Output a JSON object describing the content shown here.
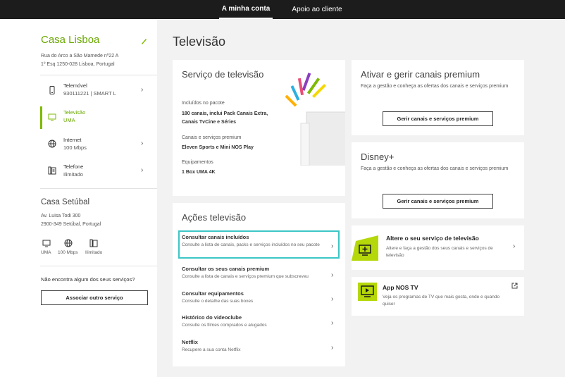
{
  "nav": {
    "tab1": "A minha conta",
    "tab2": "Apoio ao cliente"
  },
  "colors": {
    "brand": "#7dba00",
    "highlight": "#3cc6c6",
    "topbar": "#1c1c1c"
  },
  "sidebar": {
    "account1": {
      "name": "Casa Lisboa",
      "address_line1": "Rua do Arco a São Mamede nº22 A",
      "address_line2": "1º Esq 1250-028 Lisboa, Portugal",
      "services": [
        {
          "name": "Telemóvel",
          "detail": "930111221 | SMART L",
          "icon": "phone-icon"
        },
        {
          "name": "Televisão",
          "detail": "UMA",
          "icon": "tv-icon"
        },
        {
          "name": "Internet",
          "detail": "100 Mbps",
          "icon": "globe-icon"
        },
        {
          "name": "Telefone",
          "detail": "Ilimitado",
          "icon": "landline-icon"
        }
      ]
    },
    "account2": {
      "name": "Casa Setúbal",
      "address_line1": "Av. Luisa Todi 300",
      "address_line2": "2900-349 Setúbal, Portugal",
      "services": [
        {
          "label": "UMA",
          "icon": "tv-icon"
        },
        {
          "label": "100 Mbps",
          "icon": "globe-icon"
        },
        {
          "label": "Ilimitado",
          "icon": "landline-icon"
        }
      ]
    },
    "missing_text": "Não encontra algum dos seus serviços?",
    "associate_button": "Associar outro serviço"
  },
  "main": {
    "title": "Televisão",
    "tv_service": {
      "title": "Serviço de televisão",
      "included_label": "Incluídos no pacote",
      "included_value_line1": "180 canais, inclui Pack Canais Extra,",
      "included_value_line2": "Canais TvCine e Séries",
      "premium_label": "Canais e serviços premium",
      "premium_value": "Eleven Sports e Mini NOS Play",
      "equipment_label": "Equipamentos",
      "equipment_value": "1 Box UMA 4K"
    },
    "premium": {
      "title": "Ativar e gerir canais premium",
      "desc": "Faça a gestão e conheça as ofertas dos canais e serviços premium",
      "button": "Gerir canais e serviços premium"
    },
    "disney": {
      "title": "Disney+",
      "desc": "Faça a gestão e conheça as ofertas dos canais e serviços premium",
      "button": "Gerir canais e serviços premium"
    },
    "actions": {
      "title": "Ações televisão",
      "items": [
        {
          "title": "Consultar canais incluídos",
          "desc": "Consulte a lista de canais, packs e serviços incluídos no seu pacote"
        },
        {
          "title": "Consultar os seus canais premium",
          "desc": "Consulte a lista de canais e serviços premium que subscreveu"
        },
        {
          "title": "Consultar equipamentos",
          "desc": "Consulte o detalhe das suas boxes"
        },
        {
          "title": "Histórico do videoclube",
          "desc": "Consulte os filmes comprados e alugados"
        },
        {
          "title": "Netflix",
          "desc": "Recupere a sua conta Netflix"
        }
      ]
    },
    "change_service": {
      "title": "Altere o seu serviço de televisão",
      "desc": "Altere e faça a gestão dos seus canais e serviços de televisão"
    },
    "app": {
      "title": "App NOS TV",
      "desc": "Veja os programas de TV que mais gosta, onde e quando quiser"
    }
  }
}
